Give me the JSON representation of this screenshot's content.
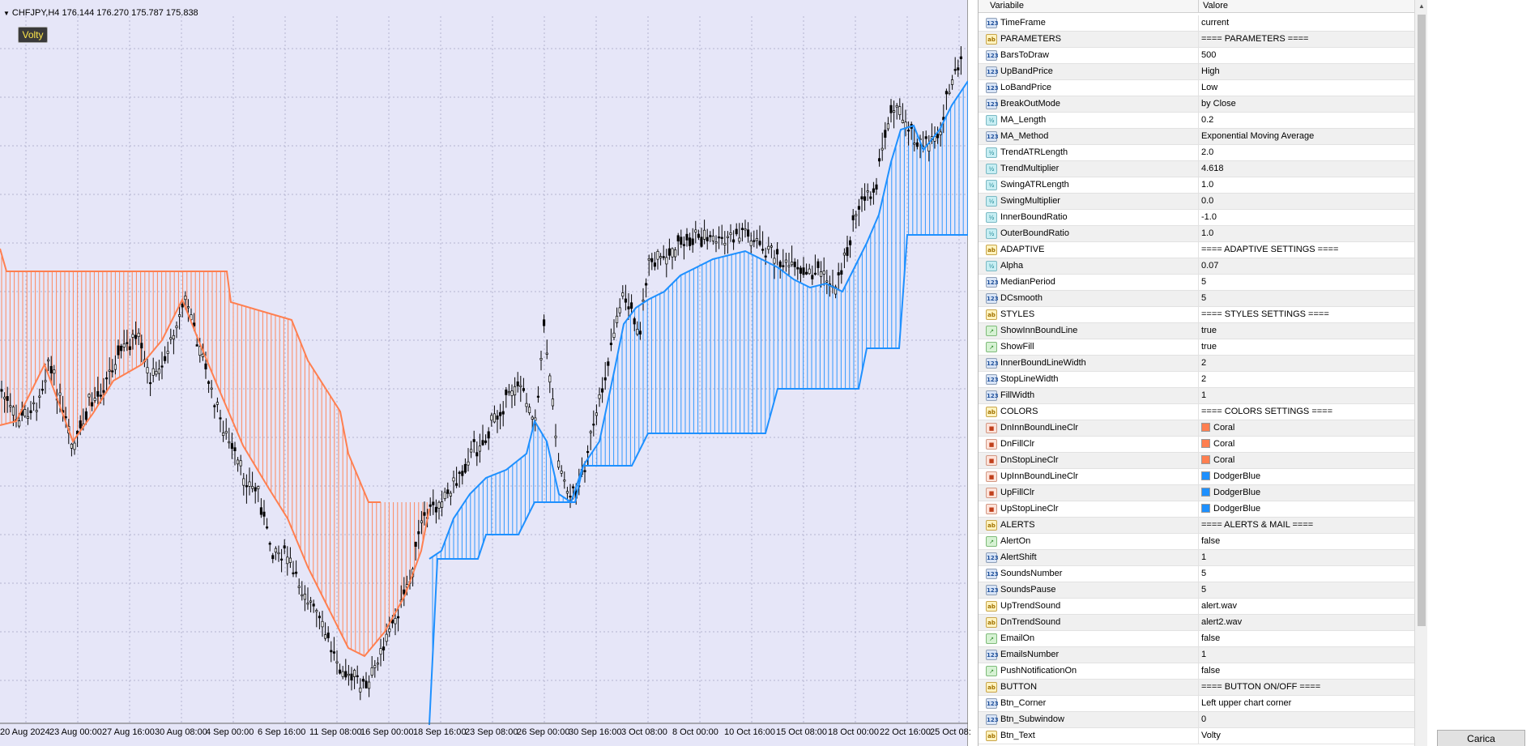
{
  "chart": {
    "header_text": "CHFJPY,H4  176.144 176.270 175.787 175.838",
    "volty_button": "Volty",
    "x_ticks": [
      "20 Aug 2024",
      "23 Aug 00:00",
      "27 Aug 16:00",
      "30 Aug 08:00",
      "4 Sep 00:00",
      "6 Sep 16:00",
      "11 Sep 08:00",
      "16 Sep 00:00",
      "18 Sep 16:00",
      "23 Sep 08:00",
      "26 Sep 00:00",
      "30 Sep 16:00",
      "3 Oct 08:00",
      "8 Oct 00:00",
      "10 Oct 16:00",
      "15 Oct 08:00",
      "18 Oct 00:00",
      "22 Oct 16:00",
      "25 Oct 08:"
    ],
    "colors": {
      "background": "#e6e6f8",
      "down": "#ff7f50",
      "up": "#1e90ff",
      "candle": "#000000"
    }
  },
  "panel": {
    "col_variable": "Variabile",
    "col_value": "Valore",
    "rows": [
      {
        "type": "int",
        "name": "TimeFrame",
        "value": "current"
      },
      {
        "type": "str",
        "name": "PARAMETERS",
        "value": "==== PARAMETERS ===="
      },
      {
        "type": "int",
        "name": "BarsToDraw",
        "value": "500"
      },
      {
        "type": "int",
        "name": "UpBandPrice",
        "value": "High"
      },
      {
        "type": "int",
        "name": "LoBandPrice",
        "value": "Low"
      },
      {
        "type": "int",
        "name": "BreakOutMode",
        "value": "by Close"
      },
      {
        "type": "dbl",
        "name": "MA_Length",
        "value": "0.2"
      },
      {
        "type": "int",
        "name": "MA_Method",
        "value": "Exponential Moving Average"
      },
      {
        "type": "dbl",
        "name": "TrendATRLength",
        "value": "2.0"
      },
      {
        "type": "dbl",
        "name": "TrendMultiplier",
        "value": "4.618"
      },
      {
        "type": "dbl",
        "name": "SwingATRLength",
        "value": "1.0"
      },
      {
        "type": "dbl",
        "name": "SwingMultiplier",
        "value": "0.0"
      },
      {
        "type": "dbl",
        "name": "InnerBoundRatio",
        "value": "-1.0"
      },
      {
        "type": "dbl",
        "name": "OuterBoundRatio",
        "value": "1.0"
      },
      {
        "type": "str",
        "name": "ADAPTIVE",
        "value": "==== ADAPTIVE SETTINGS ===="
      },
      {
        "type": "dbl",
        "name": "Alpha",
        "value": "0.07"
      },
      {
        "type": "int",
        "name": "MedianPeriod",
        "value": "5"
      },
      {
        "type": "int",
        "name": "DCsmooth",
        "value": "5"
      },
      {
        "type": "str",
        "name": "STYLES",
        "value": "==== STYLES SETTINGS ===="
      },
      {
        "type": "bool",
        "name": "ShowInnBoundLine",
        "value": "true"
      },
      {
        "type": "bool",
        "name": "ShowFill",
        "value": "true"
      },
      {
        "type": "int",
        "name": "InnerBoundLineWidth",
        "value": "2"
      },
      {
        "type": "int",
        "name": "StopLineWidth",
        "value": "2"
      },
      {
        "type": "int",
        "name": "FillWidth",
        "value": "1"
      },
      {
        "type": "str",
        "name": "COLORS",
        "value": "==== COLORS SETTINGS ===="
      },
      {
        "type": "clr",
        "name": "DnInnBoundLineClr",
        "value": "Coral",
        "color": "#ff7f50"
      },
      {
        "type": "clr",
        "name": "DnFillClr",
        "value": "Coral",
        "color": "#ff7f50"
      },
      {
        "type": "clr",
        "name": "DnStopLineClr",
        "value": "Coral",
        "color": "#ff7f50"
      },
      {
        "type": "clr",
        "name": "UpInnBoundLineClr",
        "value": "DodgerBlue",
        "color": "#1e90ff"
      },
      {
        "type": "clr",
        "name": "UpFillClr",
        "value": "DodgerBlue",
        "color": "#1e90ff"
      },
      {
        "type": "clr",
        "name": "UpStopLineClr",
        "value": "DodgerBlue",
        "color": "#1e90ff"
      },
      {
        "type": "str",
        "name": "ALERTS",
        "value": "==== ALERTS & MAIL ===="
      },
      {
        "type": "bool",
        "name": "AlertOn",
        "value": "false"
      },
      {
        "type": "int",
        "name": "AlertShift",
        "value": "1"
      },
      {
        "type": "int",
        "name": "SoundsNumber",
        "value": "5"
      },
      {
        "type": "int",
        "name": "SoundsPause",
        "value": "5"
      },
      {
        "type": "str",
        "name": "UpTrendSound",
        "value": "alert.wav"
      },
      {
        "type": "str",
        "name": "DnTrendSound",
        "value": "alert2.wav"
      },
      {
        "type": "bool",
        "name": "EmailOn",
        "value": "false"
      },
      {
        "type": "int",
        "name": "EmailsNumber",
        "value": "1"
      },
      {
        "type": "bool",
        "name": "PushNotificationOn",
        "value": "false"
      },
      {
        "type": "str",
        "name": "BUTTON",
        "value": "==== BUTTON ON/OFF ===="
      },
      {
        "type": "int",
        "name": "Btn_Corner",
        "value": "Left upper chart corner"
      },
      {
        "type": "int",
        "name": "Btn_Subwindow",
        "value": "0"
      },
      {
        "type": "str",
        "name": "Btn_Text",
        "value": "Volty"
      }
    ]
  },
  "icons": {
    "int": "123",
    "str": "ab",
    "dbl": "½",
    "bool": "↗",
    "clr": "■"
  },
  "load_button": "Carica"
}
